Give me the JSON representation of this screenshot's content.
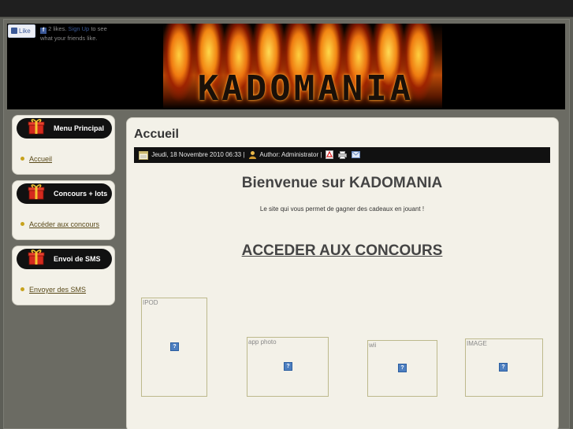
{
  "facebook": {
    "like_label": "Like",
    "likes_text": "2 likes.",
    "signup_label": "Sign Up",
    "suffix_text": "to see what your friends like."
  },
  "header": {
    "logo_text": "KADOMANIA"
  },
  "sidebar": [
    {
      "title": "Menu Principal",
      "item": "Accueil"
    },
    {
      "title": "Concours + lots",
      "item": "Accéder aux concours"
    },
    {
      "title": "Envoi de SMS",
      "item": "Envoyer des SMS"
    }
  ],
  "article": {
    "title": "Accueil",
    "date": "Jeudi, 18 Novembre 2010 06:33",
    "author": "Author: Administrator",
    "heading": "Bienvenue sur KADOMANIA",
    "subtitle": "Le site qui vous permet de gagner des cadeaux en jouant !",
    "cta": "ACCEDER AUX CONCOURS"
  },
  "images": [
    {
      "alt": "IPOD"
    },
    {
      "alt": "app photo"
    },
    {
      "alt": "wii"
    },
    {
      "alt": "IMAGE"
    }
  ],
  "icons": [
    "calendar-icon",
    "user-icon",
    "pdf-icon",
    "print-icon",
    "email-icon",
    "gift-icon",
    "broken-image-icon"
  ],
  "colors": {
    "background": "#5d5e57",
    "panel": "#f3f1e8",
    "dark": "#111111",
    "link": "#5a4a1a",
    "bullet": "#c7a21c"
  }
}
